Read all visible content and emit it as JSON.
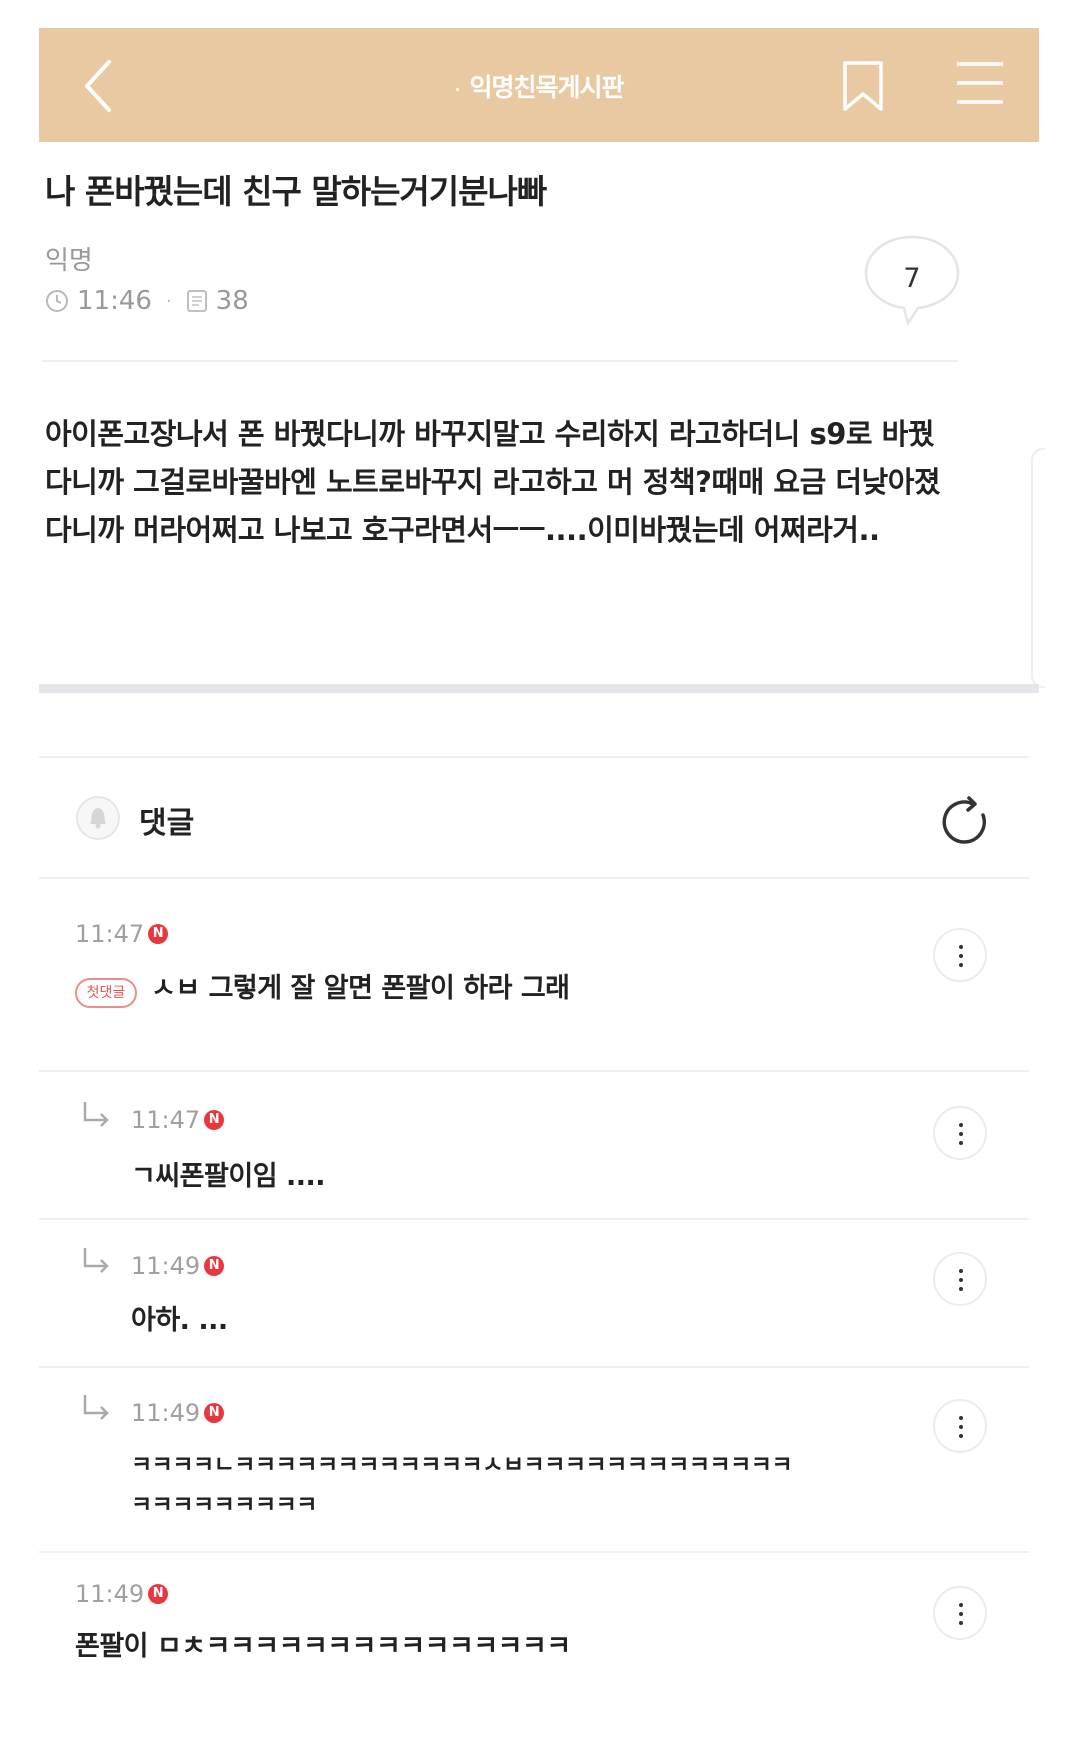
{
  "topbar": {
    "board_title": "익명친목게시판",
    "dot": "·"
  },
  "post": {
    "title": "나 폰바꿨는데 친구 말하는거기분나빠",
    "author": "익명",
    "time": "11:46",
    "separator": "·",
    "views": "38",
    "comment_count": "7",
    "body": "아이폰고장나서 폰 바꿨다니까 바꾸지말고 수리하지 라고하더니 s9로 바꿨다니까 그걸로바꿀바엔 노트로바꾸지 라고하고 머 정책?때매 요금 더낮아졌다니까 머라어쩌고 나보고 호구라면서ㅡㅡ....이미바꿨는데 어쩌라거.."
  },
  "comments_section": {
    "title": "댓글"
  },
  "comments": [
    {
      "time": "11:47",
      "badge": "N",
      "first_label": "첫댓글",
      "text": "ㅅㅂ 그렇게 잘 알면 폰팔이 하라 그래"
    },
    {
      "time": "11:47",
      "badge": "N",
      "text": "ㄱ씨폰팔이임 ...."
    },
    {
      "time": "11:49",
      "badge": "N",
      "text": "아하. ..."
    },
    {
      "time": "11:49",
      "badge": "N",
      "text_line1": "ㅋㅋㅋㅋㄴㅋㅋㅋㅋㅋㅋㅋㅋㅋㅋㅋㅋㅅㅂㅋㅋㅋㅋㅋㅋㅋㅋㅋㅋㅋㅋㅋ",
      "text_line2": "ㅋㅋㅋㅋㅋㅋㅋㅋㅋ"
    },
    {
      "time": "11:49",
      "badge": "N",
      "text": "폰팔이 ㅁㅊㅋㅋㅋㅋㅋㅋㅋㅋㅋㅋㅋㅋㅋㅋㅋ"
    }
  ],
  "colors": {
    "topbar": "#e8c9a2",
    "new_badge": "#e8383d",
    "first_badge": "#e25353"
  },
  "icons": [
    "back-arrow-icon",
    "bookmark-icon",
    "menu-icon",
    "clock-icon",
    "document-icon",
    "speech-bubble-icon",
    "bell-icon",
    "refresh-icon",
    "reply-arrow-icon",
    "more-vertical-icon"
  ]
}
